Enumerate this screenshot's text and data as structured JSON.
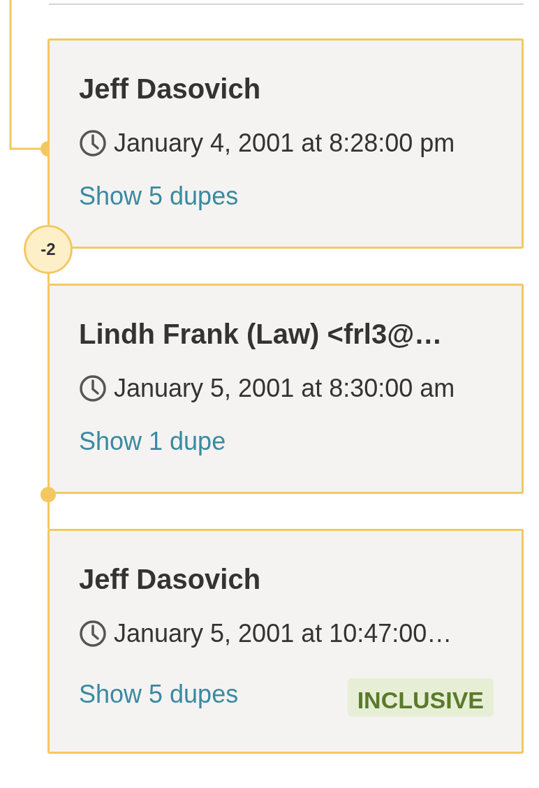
{
  "thread": [
    {
      "author": "Jeff Dasovich",
      "timestamp": "January 4, 2001 at 8:28:00 pm",
      "dupes_link": "Show 5 dupes",
      "incoming_branch": true,
      "joint_below": {
        "kind": "badge",
        "label": "-2"
      }
    },
    {
      "author": "Lindh Frank (Law) <frl3@…",
      "timestamp": "January 5, 2001 at 8:30:00 am",
      "dupes_link": "Show 1 dupe",
      "incoming_branch": false,
      "joint_below": {
        "kind": "dot"
      }
    },
    {
      "author": "Jeff Dasovich",
      "timestamp": "January 5, 2001 at 10:47:00…",
      "dupes_link": "Show 5 dupes",
      "incoming_branch": false,
      "tag": "INCLUSIVE"
    }
  ]
}
